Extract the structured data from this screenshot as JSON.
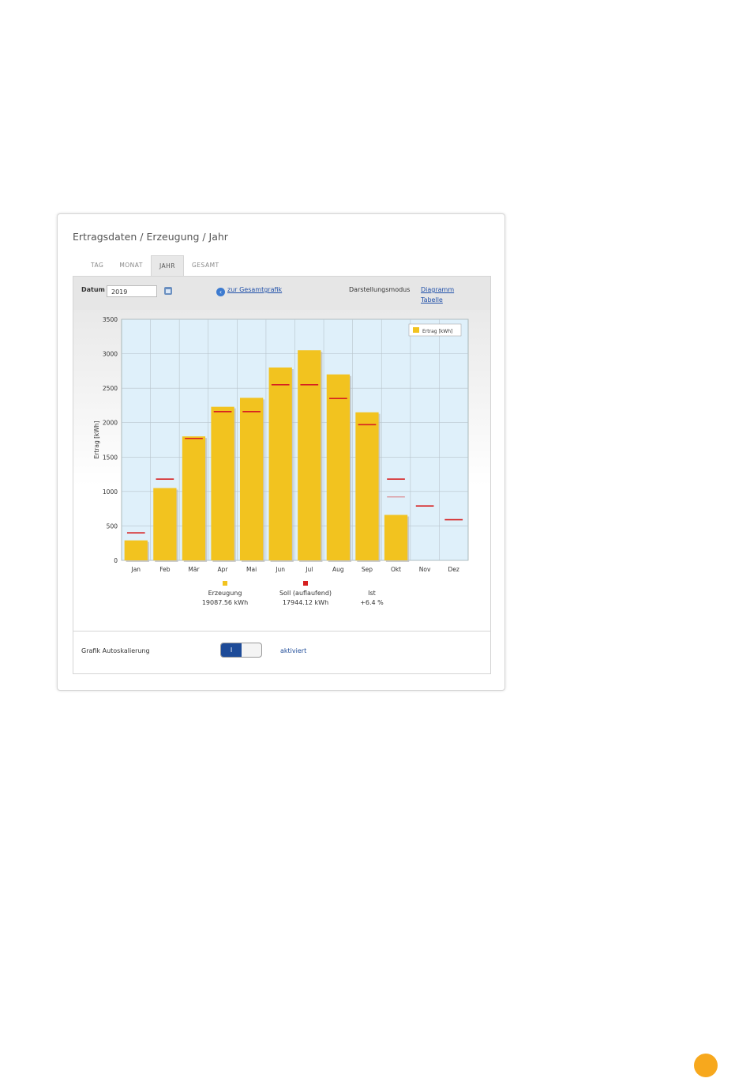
{
  "panel": {
    "title": "Ertragsdaten / Erzeugung / Jahr"
  },
  "tabs": [
    {
      "label": "TAG",
      "active": false
    },
    {
      "label": "MONAT",
      "active": false
    },
    {
      "label": "JAHR",
      "active": true
    },
    {
      "label": "GESAMT",
      "active": false
    }
  ],
  "toolbar": {
    "date_label": "Datum",
    "date_value": "2019",
    "calendar_icon": "calendar-icon",
    "back_icon": "back-arrow-icon",
    "total_link": "zur Gesamtgrafik",
    "mode_label": "Darstellungsmodus",
    "mode_diagram": "Diagramm",
    "mode_table": "Tabelle"
  },
  "summary": [
    {
      "label": "Erzeugung",
      "value": "19087.56 kWh",
      "color": "#f2c31f"
    },
    {
      "label": "Soll (auflaufend)",
      "value": "17944.12 kWh",
      "color": "#d62020"
    },
    {
      "label": "Ist",
      "value": "+6.4 %"
    }
  ],
  "autoscale": {
    "label": "Grafik Autoskalierung",
    "toggle_text": "I",
    "status": "aktiviert",
    "enabled": true
  },
  "colors": {
    "bar": "#f2c31f",
    "target": "#d62020",
    "plot_bg": "#dff0fa",
    "accent": "#f7a81d"
  },
  "chart_data": {
    "type": "bar",
    "categories": [
      "Jan",
      "Feb",
      "Mär",
      "Apr",
      "Mai",
      "Jun",
      "Jul",
      "Aug",
      "Sep",
      "Okt",
      "Nov",
      "Dez"
    ],
    "series": [
      {
        "name": "Ertrag [kWh]",
        "values": [
          290,
          1050,
          1800,
          2230,
          2360,
          2800,
          3050,
          2700,
          2150,
          660,
          0,
          0
        ]
      }
    ],
    "target": [
      400,
      1180,
      1770,
      2160,
      2160,
      2550,
      2550,
      2350,
      1970,
      1180,
      790,
      590
    ],
    "target_secondary": [
      null,
      null,
      null,
      null,
      null,
      null,
      null,
      null,
      null,
      920,
      null,
      null
    ],
    "ylabel": "Ertrag [kWh]",
    "xlabel": "",
    "ylim": [
      0,
      3500
    ],
    "yticks": [
      0,
      500,
      1000,
      1500,
      2000,
      2500,
      3000,
      3500
    ],
    "grid": true,
    "legend": "top-right"
  }
}
